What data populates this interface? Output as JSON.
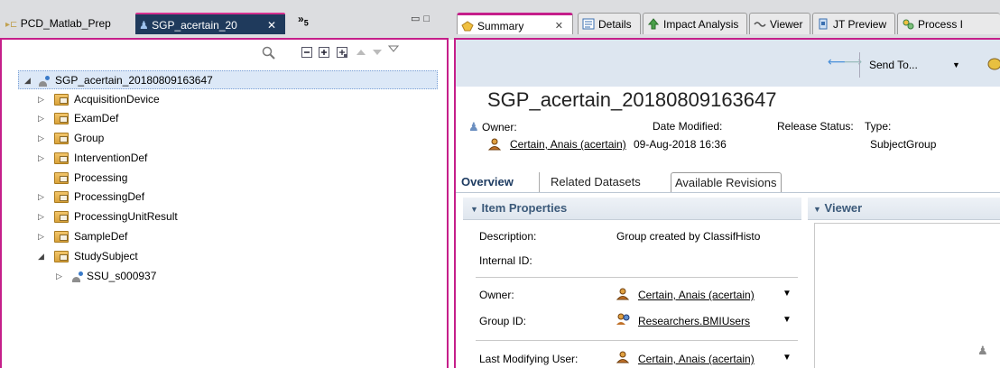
{
  "left_pane": {
    "tab_inactive": "PCD_Matlab_Prep",
    "tab_active": "SGP_acertain_20",
    "tab_close": "✕",
    "tab_overflow": "»",
    "tab_overflow_count": "5",
    "tree": {
      "root": "SGP_acertain_20180809163647",
      "items": [
        {
          "label": "AcquisitionDevice",
          "expandable": true
        },
        {
          "label": "ExamDef",
          "expandable": true
        },
        {
          "label": "Group",
          "expandable": true
        },
        {
          "label": "InterventionDef",
          "expandable": true
        },
        {
          "label": "Processing",
          "expandable": false
        },
        {
          "label": "ProcessingDef",
          "expandable": true
        },
        {
          "label": "ProcessingUnitResult",
          "expandable": true
        },
        {
          "label": "SampleDef",
          "expandable": true
        },
        {
          "label": "StudySubject",
          "expandable": true,
          "expanded": true
        }
      ],
      "child": "SSU_s000937"
    }
  },
  "right_pane": {
    "tabs": [
      {
        "label": "Summary",
        "icon": "summary-icon"
      },
      {
        "label": "Details",
        "icon": "details-icon"
      },
      {
        "label": "Impact Analysis",
        "icon": "impact-icon"
      },
      {
        "label": "Viewer",
        "icon": "viewer-icon"
      },
      {
        "label": "JT Preview",
        "icon": "jt-icon"
      },
      {
        "label": "Process I",
        "icon": "process-icon"
      }
    ],
    "send_to": "Send To...",
    "title": "SGP_acertain_20180809163647",
    "header": {
      "owner_label": "Owner:",
      "date_label": "Date Modified:",
      "release_label": "Release Status:",
      "type_label": "Type:",
      "owner_value": "Certain, Anais (acertain)",
      "date_value": "09-Aug-2018 16:36",
      "type_value": "SubjectGroup"
    },
    "subtabs": {
      "overview": "Overview",
      "related": "Related Datasets",
      "available": "Available Revisions"
    },
    "item_properties": {
      "heading": "Item Properties",
      "description_label": "Description:",
      "description_value": "Group created by ClassifHisto",
      "internal_id_label": "Internal ID:",
      "owner_label": "Owner:",
      "owner_value": "Certain, Anais (acertain)",
      "group_label": "Group ID:",
      "group_value": "Researchers.BMIUsers",
      "lmu_label": "Last Modifying User:",
      "lmu_value": "Certain, Anais (acertain)"
    },
    "viewer_heading": "Viewer"
  },
  "colors": {
    "active_border": "#c51f8a",
    "active_tab_bg": "#1f3a5c",
    "selection_bg": "#dce8f7"
  }
}
